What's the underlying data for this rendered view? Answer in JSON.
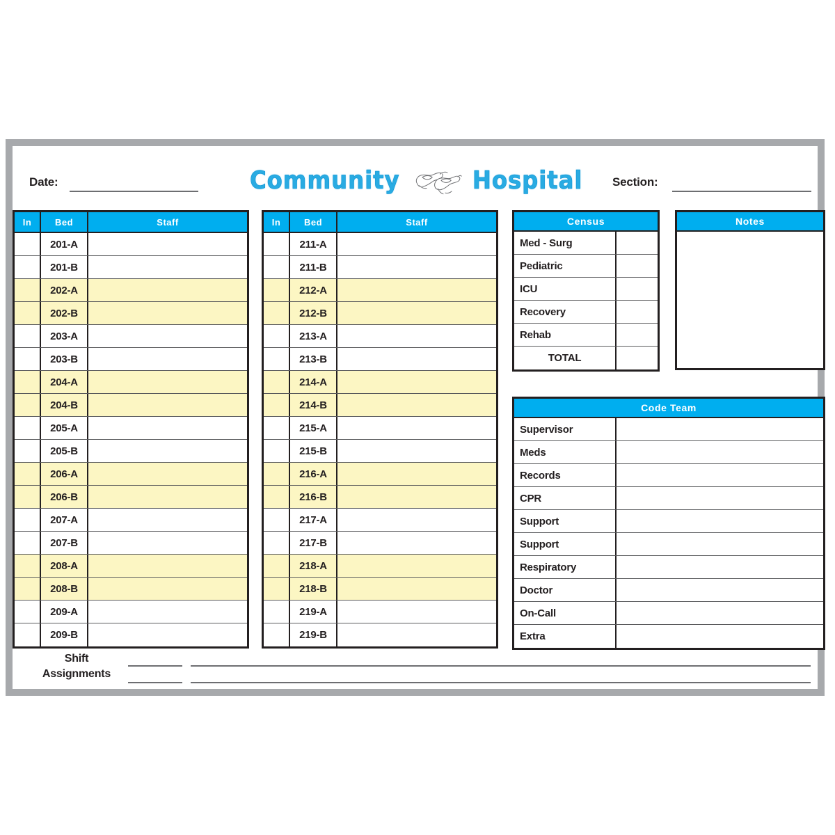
{
  "header": {
    "date_label": "Date:",
    "section_label": "Section:",
    "title_word_1": "Community",
    "title_word_2": "Hospital",
    "logo_icon": "dove-pair-icon",
    "title_color": "#29abe2"
  },
  "colors": {
    "header_blue": "#00aeef",
    "highlight_yellow": "#fcf6c3",
    "frame_gray": "#a7a9ac",
    "ink": "#231f20"
  },
  "bed_tables": [
    {
      "columns": [
        "In",
        "Bed",
        "Staff"
      ],
      "rows": [
        {
          "bed": "201-A",
          "staff": "",
          "highlight": false
        },
        {
          "bed": "201-B",
          "staff": "",
          "highlight": false
        },
        {
          "bed": "202-A",
          "staff": "",
          "highlight": true
        },
        {
          "bed": "202-B",
          "staff": "",
          "highlight": true
        },
        {
          "bed": "203-A",
          "staff": "",
          "highlight": false
        },
        {
          "bed": "203-B",
          "staff": "",
          "highlight": false
        },
        {
          "bed": "204-A",
          "staff": "",
          "highlight": true
        },
        {
          "bed": "204-B",
          "staff": "",
          "highlight": true
        },
        {
          "bed": "205-A",
          "staff": "",
          "highlight": false
        },
        {
          "bed": "205-B",
          "staff": "",
          "highlight": false
        },
        {
          "bed": "206-A",
          "staff": "",
          "highlight": true
        },
        {
          "bed": "206-B",
          "staff": "",
          "highlight": true
        },
        {
          "bed": "207-A",
          "staff": "",
          "highlight": false
        },
        {
          "bed": "207-B",
          "staff": "",
          "highlight": false
        },
        {
          "bed": "208-A",
          "staff": "",
          "highlight": true
        },
        {
          "bed": "208-B",
          "staff": "",
          "highlight": true
        },
        {
          "bed": "209-A",
          "staff": "",
          "highlight": false
        },
        {
          "bed": "209-B",
          "staff": "",
          "highlight": false
        }
      ]
    },
    {
      "columns": [
        "In",
        "Bed",
        "Staff"
      ],
      "rows": [
        {
          "bed": "211-A",
          "staff": "",
          "highlight": false
        },
        {
          "bed": "211-B",
          "staff": "",
          "highlight": false
        },
        {
          "bed": "212-A",
          "staff": "",
          "highlight": true
        },
        {
          "bed": "212-B",
          "staff": "",
          "highlight": true
        },
        {
          "bed": "213-A",
          "staff": "",
          "highlight": false
        },
        {
          "bed": "213-B",
          "staff": "",
          "highlight": false
        },
        {
          "bed": "214-A",
          "staff": "",
          "highlight": true
        },
        {
          "bed": "214-B",
          "staff": "",
          "highlight": true
        },
        {
          "bed": "215-A",
          "staff": "",
          "highlight": false
        },
        {
          "bed": "215-B",
          "staff": "",
          "highlight": false
        },
        {
          "bed": "216-A",
          "staff": "",
          "highlight": true
        },
        {
          "bed": "216-B",
          "staff": "",
          "highlight": true
        },
        {
          "bed": "217-A",
          "staff": "",
          "highlight": false
        },
        {
          "bed": "217-B",
          "staff": "",
          "highlight": false
        },
        {
          "bed": "218-A",
          "staff": "",
          "highlight": true
        },
        {
          "bed": "218-B",
          "staff": "",
          "highlight": true
        },
        {
          "bed": "219-A",
          "staff": "",
          "highlight": false
        },
        {
          "bed": "219-B",
          "staff": "",
          "highlight": false
        }
      ]
    }
  ],
  "census": {
    "title": "Census",
    "rows": [
      {
        "label": "Med - Surg",
        "value": "",
        "centered": false
      },
      {
        "label": "Pediatric",
        "value": "",
        "centered": false
      },
      {
        "label": "ICU",
        "value": "",
        "centered": false
      },
      {
        "label": "Recovery",
        "value": "",
        "centered": false
      },
      {
        "label": "Rehab",
        "value": "",
        "centered": false
      },
      {
        "label": "TOTAL",
        "value": "",
        "centered": true
      }
    ]
  },
  "notes": {
    "title": "Notes",
    "body": ""
  },
  "code_team": {
    "title": "Code Team",
    "rows": [
      {
        "label": "Supervisor",
        "value": ""
      },
      {
        "label": "Meds",
        "value": ""
      },
      {
        "label": "Records",
        "value": ""
      },
      {
        "label": "CPR",
        "value": ""
      },
      {
        "label": "Support",
        "value": ""
      },
      {
        "label": "Support",
        "value": ""
      },
      {
        "label": "Respiratory",
        "value": ""
      },
      {
        "label": "Doctor",
        "value": ""
      },
      {
        "label": "On-Call",
        "value": ""
      },
      {
        "label": "Extra",
        "value": ""
      }
    ]
  },
  "shift_assignments": {
    "label_line_1": "Shift",
    "label_line_2": "Assignments",
    "short_lines": 2,
    "long_lines": 2
  }
}
